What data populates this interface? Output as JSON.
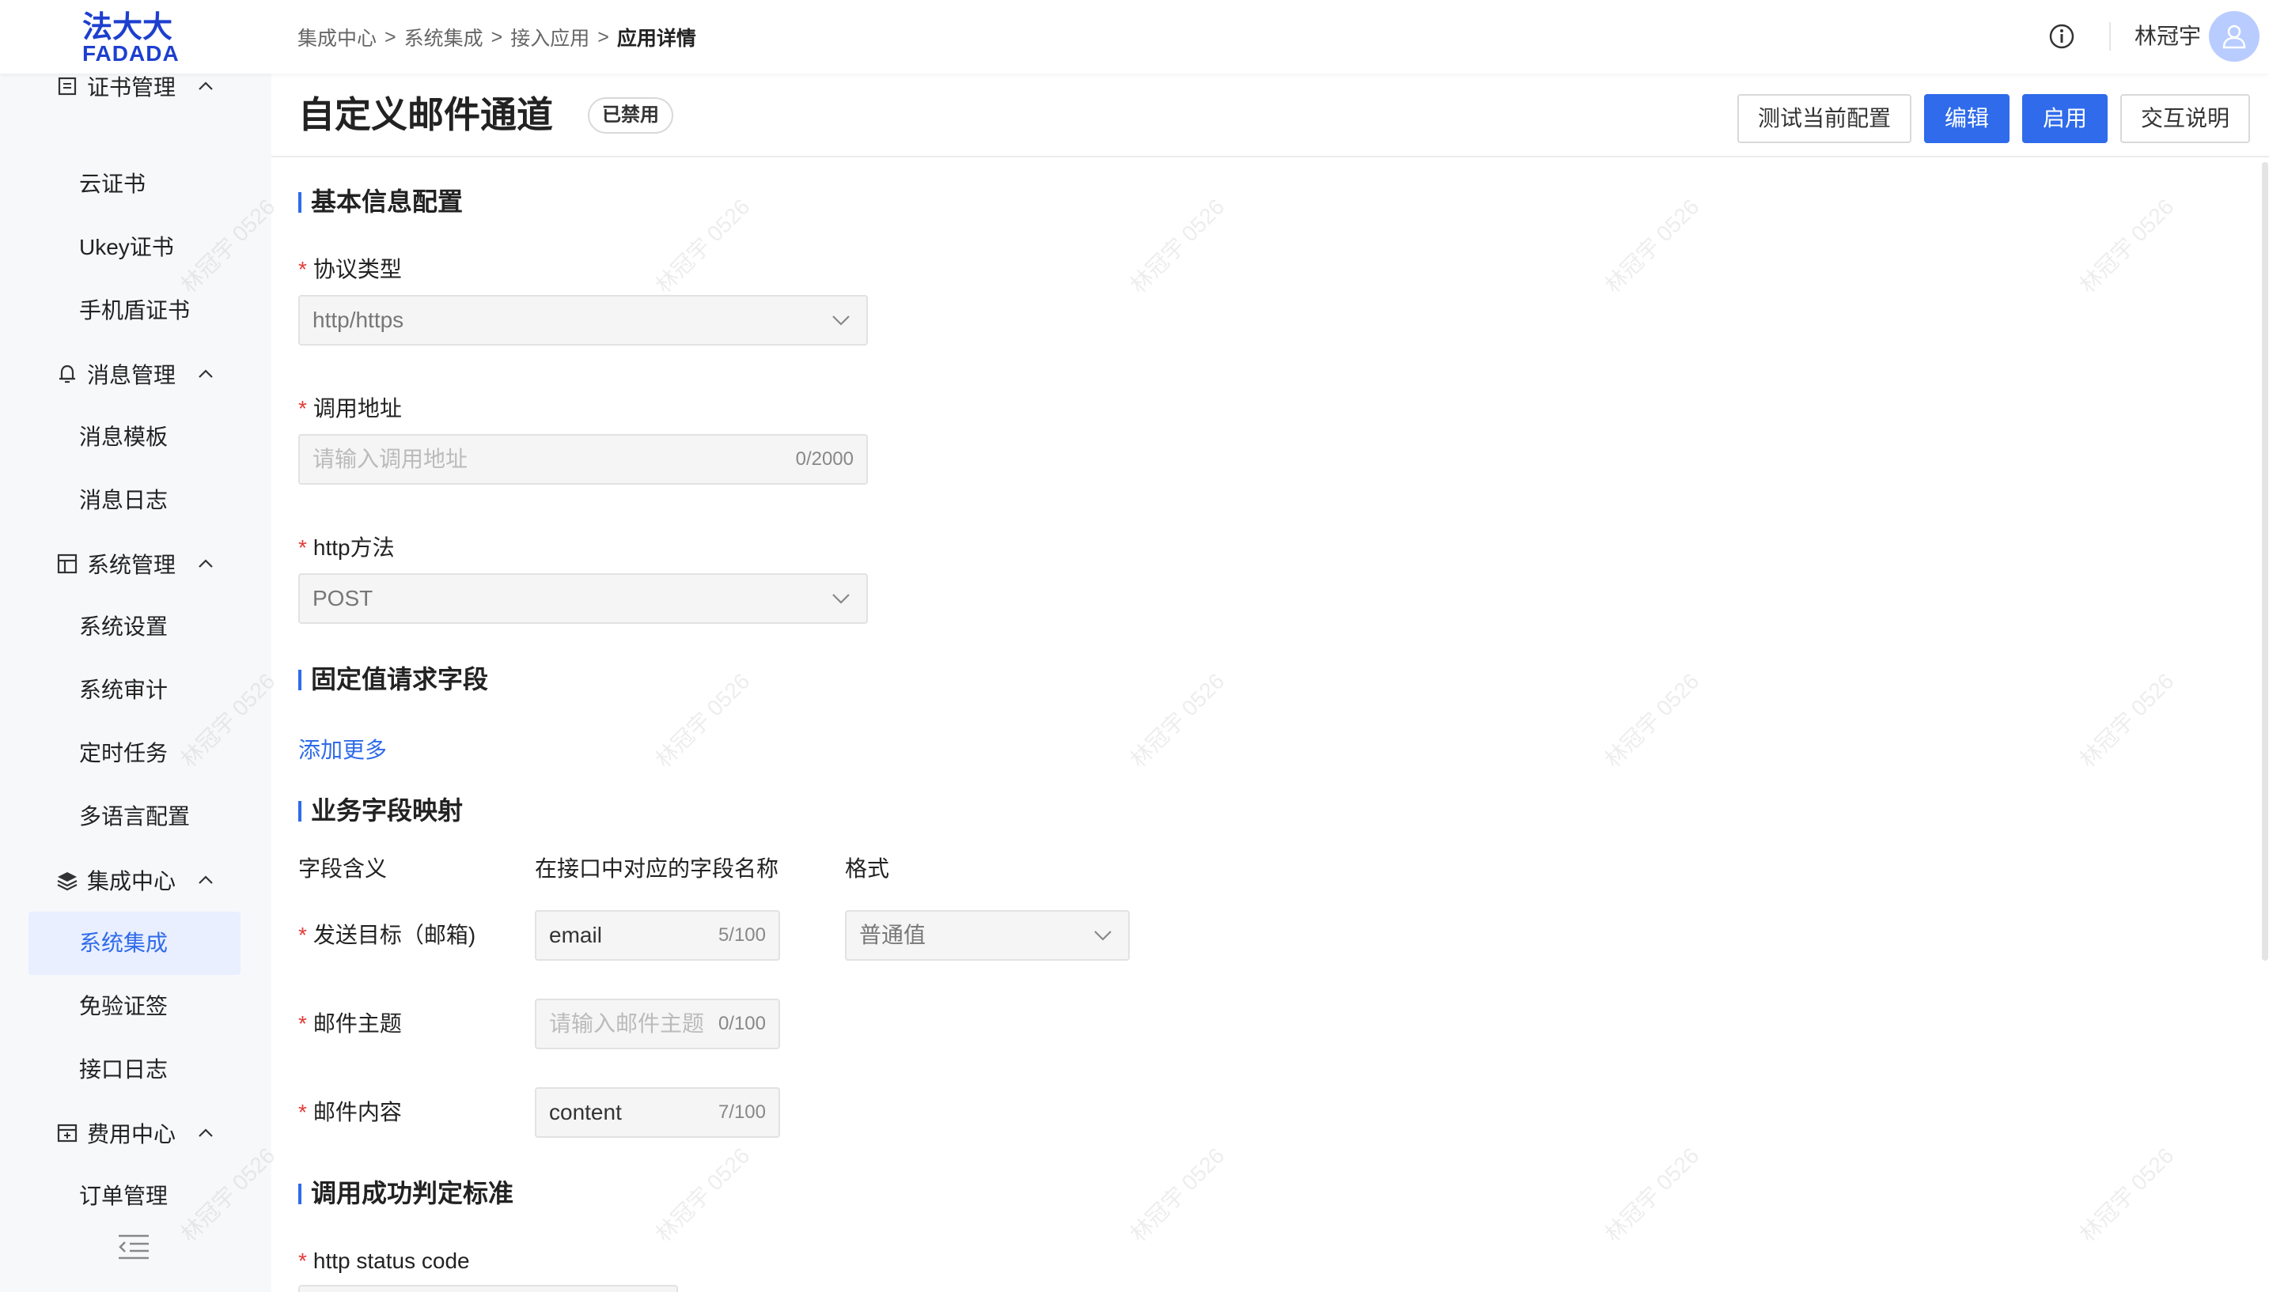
{
  "header": {
    "logo_line1": "法大大",
    "logo_line2": "FADADA",
    "breadcrumb": [
      "集成中心",
      "系统集成",
      "接入应用",
      "应用详情"
    ],
    "breadcrumb_sep": ">",
    "username": "林冠宇"
  },
  "sidebar": {
    "groups": [
      {
        "label": "证书管理",
        "icon": "certificate-icon"
      },
      {
        "label": "消息管理",
        "icon": "bell-icon"
      },
      {
        "label": "系统管理",
        "icon": "layout-icon"
      },
      {
        "label": "集成中心",
        "icon": "layers-icon"
      },
      {
        "label": "费用中心",
        "icon": "billing-icon"
      }
    ],
    "items": [
      "云证书",
      "Ukey证书",
      "手机盾证书",
      "消息模板",
      "消息日志",
      "系统设置",
      "系统审计",
      "定时任务",
      "多语言配置",
      "系统集成",
      "免验证签",
      "接口日志",
      "订单管理"
    ],
    "active_item": "系统集成"
  },
  "page": {
    "title": "自定义邮件通道",
    "status": "已禁用",
    "buttons": {
      "test": "测试当前配置",
      "edit": "编辑",
      "enable": "启用",
      "help": "交互说明"
    }
  },
  "basic": {
    "section": "基本信息配置",
    "protocol_label": "协议类型",
    "protocol_value": "http/https",
    "url_label": "调用地址",
    "url_placeholder": "请输入调用地址",
    "url_count": "0/2000",
    "method_label": "http方法",
    "method_value": "POST"
  },
  "fixed": {
    "section": "固定值请求字段",
    "add_more": "添加更多"
  },
  "mapping": {
    "section": "业务字段映射",
    "headers": [
      "字段含义",
      "在接口中对应的字段名称",
      "格式"
    ],
    "rows": [
      {
        "label": "发送目标（邮箱)",
        "value": "email",
        "placeholder": "",
        "count": "5/100",
        "format": "普通值"
      },
      {
        "label": "邮件主题",
        "value": "",
        "placeholder": "请输入邮件主题",
        "count": "0/100"
      },
      {
        "label": "邮件内容",
        "value": "content",
        "placeholder": "",
        "count": "7/100"
      }
    ]
  },
  "success": {
    "section": "调用成功判定标准",
    "status_code_label": "http status code"
  },
  "watermark": "林冠宇 0526",
  "colors": {
    "primary": "#2f6bea",
    "required": "#e23c39",
    "brand": "#1d3fcf"
  }
}
